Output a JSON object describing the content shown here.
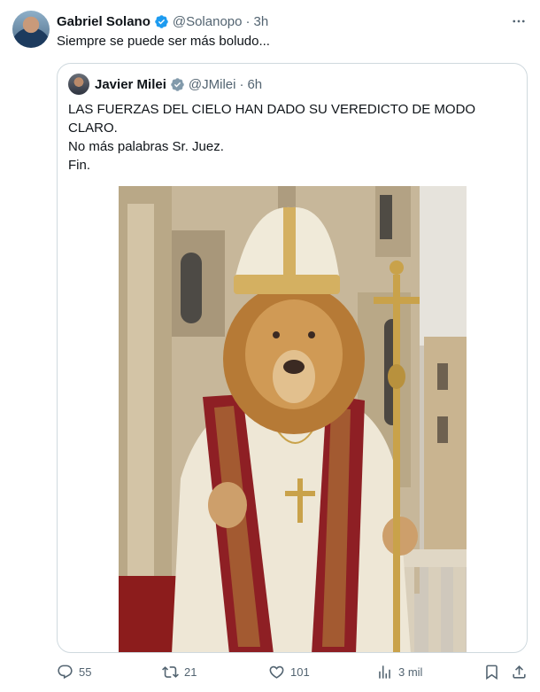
{
  "post": {
    "author_name": "Gabriel Solano",
    "author_handle": "@Solanopo",
    "separator": "·",
    "time": "3h",
    "text": "Siempre se puede ser más boludo..."
  },
  "quoted": {
    "author_name": "Javier Milei",
    "author_handle": "@JMilei",
    "separator": "·",
    "time": "6h",
    "lines": [
      "LAS FUERZAS DEL CIELO HAN DADO SU VEREDICTO DE MODO CLARO.",
      "No más palabras Sr. Juez.",
      "Fin."
    ]
  },
  "metrics": {
    "replies": "55",
    "reposts": "21",
    "likes": "101",
    "views": "3 mil"
  },
  "colors": {
    "verified": "#1d9bf0",
    "secondary_text": "#536471",
    "border": "#cfd9de"
  },
  "icons": [
    "more-icon",
    "verified-icon",
    "reply-icon",
    "repost-icon",
    "like-icon",
    "views-icon",
    "bookmark-icon",
    "share-icon"
  ]
}
